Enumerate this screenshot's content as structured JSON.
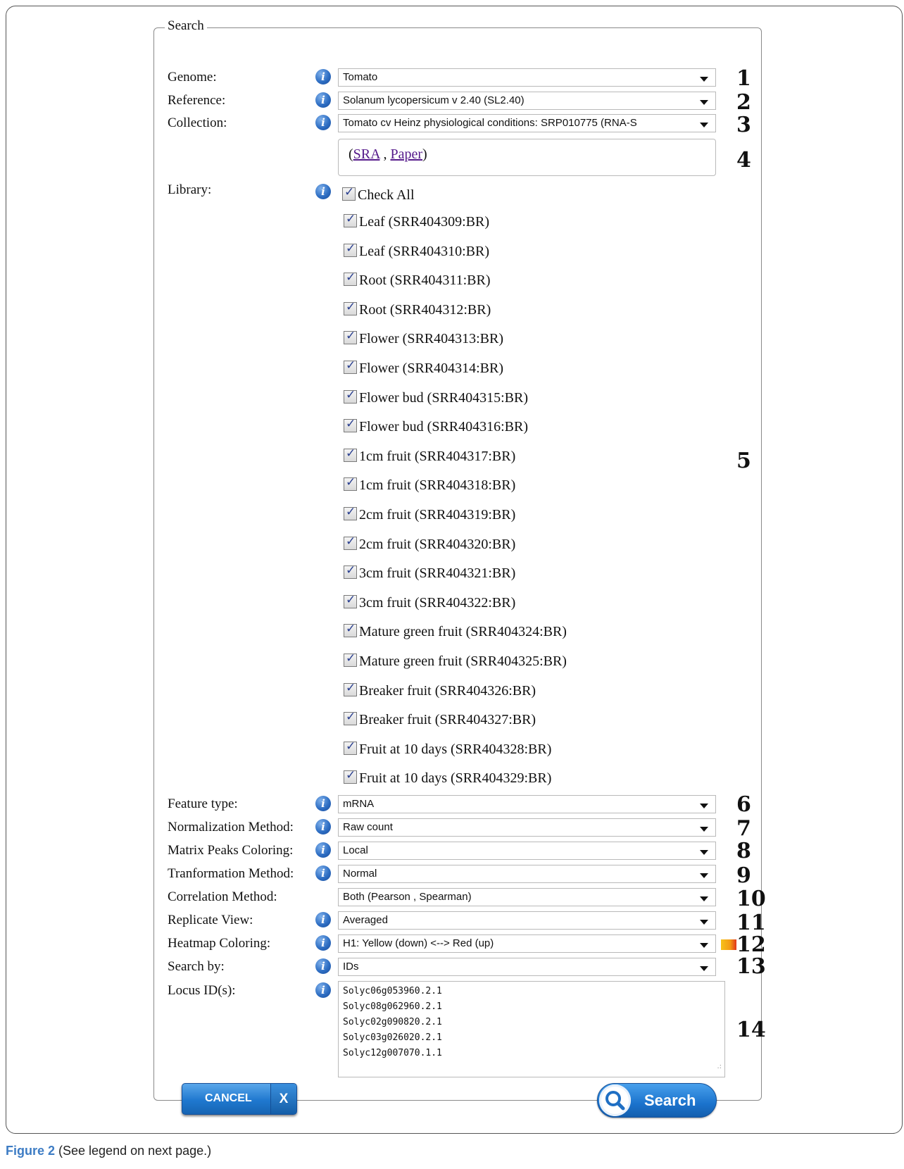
{
  "form": {
    "legend": "Search",
    "fields": {
      "genome": {
        "label": "Genome:",
        "value": "Tomato",
        "callout": "1"
      },
      "reference": {
        "label": "Reference:",
        "value": "Solanum lycopersicum v 2.40 (SL2.40)",
        "callout": "2"
      },
      "collection": {
        "label": "Collection:",
        "value": "Tomato cv Heinz physiological conditions: SRP010775 (RNA-S",
        "callout": "3"
      },
      "links": {
        "open": "(",
        "sra": "SRA",
        "sep": " , ",
        "paper": "Paper",
        "close": ")",
        "callout": "4"
      },
      "library": {
        "label": "Library:",
        "check_all": "Check All",
        "callout": "5",
        "items": [
          "Leaf (SRR404309:BR)",
          "Leaf (SRR404310:BR)",
          "Root (SRR404311:BR)",
          "Root (SRR404312:BR)",
          "Flower (SRR404313:BR)",
          "Flower (SRR404314:BR)",
          "Flower bud (SRR404315:BR)",
          "Flower bud (SRR404316:BR)",
          "1cm fruit (SRR404317:BR)",
          "1cm fruit (SRR404318:BR)",
          "2cm fruit (SRR404319:BR)",
          "2cm fruit (SRR404320:BR)",
          "3cm fruit (SRR404321:BR)",
          "3cm fruit (SRR404322:BR)",
          "Mature green fruit (SRR404324:BR)",
          "Mature green fruit (SRR404325:BR)",
          "Breaker fruit (SRR404326:BR)",
          "Breaker fruit (SRR404327:BR)",
          "Fruit at 10 days (SRR404328:BR)",
          "Fruit at 10 days (SRR404329:BR)"
        ]
      },
      "feature_type": {
        "label": "Feature type:",
        "value": "mRNA",
        "callout": "6"
      },
      "normalization": {
        "label": "Normalization Method:",
        "value": "Raw count",
        "callout": "7"
      },
      "matrix_peaks": {
        "label": "Matrix Peaks Coloring:",
        "value": "Local",
        "callout": "8"
      },
      "transformation": {
        "label": "Tranformation Method:",
        "value": "Normal",
        "callout": "9"
      },
      "correlation": {
        "label": "Correlation Method:",
        "value": "Both (Pearson , Spearman)",
        "callout": "10"
      },
      "replicate": {
        "label": "Replicate View:",
        "value": "Averaged",
        "callout": "11"
      },
      "heatmap": {
        "label": "Heatmap Coloring:",
        "value": "H1: Yellow (down) <--> Red (up)",
        "callout": "12"
      },
      "search_by": {
        "label": "Search by:",
        "value": "IDs",
        "callout": "13"
      },
      "locus": {
        "label": "Locus ID(s):",
        "value": "Solyc06g053960.2.1\nSolyc08g062960.2.1\nSolyc02g090820.2.1\nSolyc03g026020.2.1\nSolyc12g007070.1.1",
        "callout": "14"
      }
    },
    "info_icon_glyph": "i",
    "buttons": {
      "cancel": "CANCEL",
      "cancel_x": "X",
      "search": "Search"
    }
  },
  "caption": {
    "figure": "Figure 2",
    "text": " (See legend on next page.)"
  },
  "colors": {
    "accent_blue": "#1f78cf",
    "link": "#551a8b",
    "heatmap_low": "#f6c219",
    "heatmap_high": "#e0341c"
  }
}
